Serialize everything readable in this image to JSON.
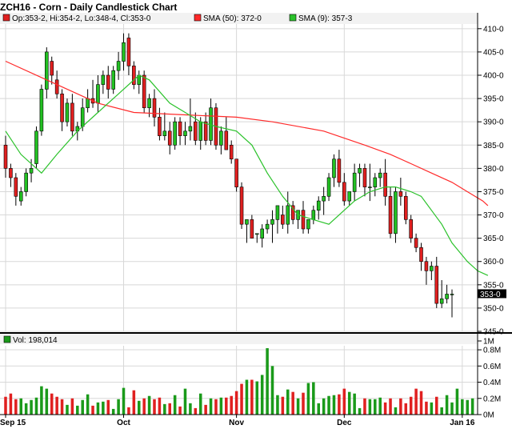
{
  "chart_data": {
    "type": "candlestick",
    "title": "ZCH16 - Corn - Daily Candlestick Chart",
    "legend": {
      "ohlc": "Op:353-2, Hi:354-2, Lo:348-4, Cl:353-0",
      "sma50": "SMA (50): 372-0",
      "sma9": "SMA (9): 357-3",
      "volume": "Vol: 198,014"
    },
    "last_price_label": "353-0",
    "colors": {
      "up": "#22c022",
      "down": "#e02020",
      "sma50": "#ff2a2a",
      "sma9": "#2bc22b",
      "vol_up": "#1a9a1a",
      "vol_down": "#e02020"
    },
    "price_axis": {
      "ylim": [
        345,
        411
      ],
      "ticks": [
        "345-0",
        "350-0",
        "355-0",
        "360-0",
        "365-0",
        "370-0",
        "375-0",
        "380-0",
        "385-0",
        "390-0",
        "395-0",
        "400-0",
        "405-0",
        "410-0"
      ]
    },
    "volume_axis": {
      "ylim": [
        0,
        0.85
      ],
      "ticks": [
        "0M",
        "0.2M",
        "0.4M",
        "0.6M",
        "0.8M",
        "1M"
      ]
    },
    "x_labels": [
      {
        "label": "Sep 15",
        "index": 0
      },
      {
        "label": "Oct",
        "index": 23
      },
      {
        "label": "Nov",
        "index": 45
      },
      {
        "label": "Dec",
        "index": 66
      },
      {
        "label": "Jan 16",
        "index": 89
      }
    ],
    "candles": [
      [
        385,
        387,
        378,
        380
      ],
      [
        380,
        381,
        376,
        378
      ],
      [
        378,
        379,
        372,
        374
      ],
      [
        373,
        376,
        372,
        375
      ],
      [
        375,
        380,
        374,
        379
      ],
      [
        379,
        382,
        377,
        380
      ],
      [
        381,
        389,
        380,
        388
      ],
      [
        388,
        398,
        387,
        397
      ],
      [
        397,
        406,
        395,
        405
      ],
      [
        403,
        404,
        398,
        400
      ],
      [
        399,
        401,
        395,
        396
      ],
      [
        396,
        397,
        388,
        390
      ],
      [
        390,
        395,
        389,
        394
      ],
      [
        394,
        396,
        387,
        388
      ],
      [
        388,
        390,
        386,
        389
      ],
      [
        389,
        395,
        388,
        393
      ],
      [
        393,
        397,
        392,
        395
      ],
      [
        395,
        399,
        393,
        394
      ],
      [
        394,
        400,
        392,
        398
      ],
      [
        398,
        401,
        396,
        400
      ],
      [
        400,
        402,
        395,
        397
      ],
      [
        397,
        402,
        396,
        401
      ],
      [
        401,
        405,
        399,
        403
      ],
      [
        403,
        409,
        401,
        407
      ],
      [
        408,
        409,
        400,
        402
      ],
      [
        402,
        403,
        397,
        398
      ],
      [
        398,
        401,
        396,
        400
      ],
      [
        400,
        401,
        392,
        393
      ],
      [
        393,
        396,
        391,
        395
      ],
      [
        395,
        397,
        389,
        391
      ],
      [
        391,
        393,
        386,
        387
      ],
      [
        387,
        392,
        386,
        388
      ],
      [
        388,
        390,
        383,
        385
      ],
      [
        385,
        391,
        384,
        390
      ],
      [
        390,
        391,
        385,
        387
      ],
      [
        387,
        390,
        385,
        388
      ],
      [
        388,
        395,
        386,
        389
      ],
      [
        390,
        392,
        385,
        386
      ],
      [
        386,
        391,
        384,
        390
      ],
      [
        390,
        392,
        385,
        386
      ],
      [
        386,
        395,
        385,
        393
      ],
      [
        393,
        394,
        384,
        385
      ],
      [
        385,
        389,
        383,
        388
      ],
      [
        388,
        391,
        384,
        384
      ],
      [
        385,
        386,
        381,
        382
      ],
      [
        382,
        382,
        375,
        376
      ],
      [
        376,
        377,
        367,
        368
      ],
      [
        368,
        369,
        364,
        369
      ],
      [
        369,
        370,
        365,
        365
      ],
      [
        366,
        366,
        364,
        366
      ],
      [
        365,
        368,
        363,
        367
      ],
      [
        367,
        369,
        366,
        368
      ],
      [
        368,
        371,
        364,
        369
      ],
      [
        369,
        372,
        366,
        372
      ],
      [
        370,
        372,
        367,
        368
      ],
      [
        368,
        375,
        366,
        372
      ],
      [
        372,
        373,
        368,
        369
      ],
      [
        369,
        371,
        367,
        371
      ],
      [
        371,
        373,
        366,
        367
      ],
      [
        367,
        369,
        366,
        369
      ],
      [
        369,
        372,
        368,
        371
      ],
      [
        371,
        374,
        369,
        373
      ],
      [
        373,
        376,
        370,
        374
      ],
      [
        374,
        379,
        373,
        378
      ],
      [
        378,
        383,
        376,
        382
      ],
      [
        382,
        384,
        376,
        377
      ],
      [
        377,
        379,
        372,
        373
      ],
      [
        373,
        375,
        372,
        375
      ],
      [
        375,
        381,
        373,
        379
      ],
      [
        379,
        381,
        376,
        380
      ],
      [
        380,
        381,
        374,
        376
      ],
      [
        376,
        381,
        373,
        376
      ],
      [
        376,
        379,
        374,
        378
      ],
      [
        378,
        380,
        376,
        379
      ],
      [
        379,
        382,
        372,
        374
      ],
      [
        374,
        376,
        365,
        366
      ],
      [
        366,
        376,
        364,
        375
      ],
      [
        375,
        378,
        372,
        374
      ],
      [
        374,
        375,
        368,
        369
      ],
      [
        369,
        370,
        364,
        365
      ],
      [
        365,
        366,
        362,
        363
      ],
      [
        363,
        364,
        358,
        360
      ],
      [
        360,
        361,
        355,
        358
      ],
      [
        358,
        360,
        356,
        359
      ],
      [
        359,
        361,
        350,
        351
      ],
      [
        351,
        356,
        350,
        352
      ],
      [
        352,
        355,
        351,
        353
      ],
      [
        353,
        354,
        348,
        353
      ]
    ],
    "sma50": [
      [
        0,
        403
      ],
      [
        8,
        399
      ],
      [
        18,
        394
      ],
      [
        25,
        392
      ],
      [
        35,
        391.5
      ],
      [
        45,
        391
      ],
      [
        52,
        390
      ],
      [
        62,
        388
      ],
      [
        70,
        385
      ],
      [
        75,
        383
      ],
      [
        79,
        381
      ],
      [
        83,
        379
      ],
      [
        87,
        377
      ],
      [
        90,
        375
      ],
      [
        93,
        373
      ],
      [
        94,
        372
      ]
    ],
    "sma9": [
      [
        0,
        388
      ],
      [
        3,
        383
      ],
      [
        7,
        379
      ],
      [
        10,
        383
      ],
      [
        14,
        388
      ],
      [
        18,
        392
      ],
      [
        22,
        396
      ],
      [
        26,
        400
      ],
      [
        28,
        399
      ],
      [
        32,
        394
      ],
      [
        35,
        392
      ],
      [
        38,
        390
      ],
      [
        41,
        389
      ],
      [
        45,
        388
      ],
      [
        48,
        385
      ],
      [
        51,
        379
      ],
      [
        54,
        374
      ],
      [
        57,
        370
      ],
      [
        60,
        369
      ],
      [
        63,
        368
      ],
      [
        66,
        371
      ],
      [
        68,
        373
      ],
      [
        71,
        375
      ],
      [
        74,
        376
      ],
      [
        76,
        376
      ],
      [
        79,
        375
      ],
      [
        81,
        374
      ],
      [
        83,
        371
      ],
      [
        85,
        368
      ],
      [
        87,
        364
      ],
      [
        90,
        360
      ],
      [
        92,
        358
      ],
      [
        94,
        357
      ]
    ],
    "volume": [
      0.22,
      0.26,
      0.19,
      0.2,
      0.14,
      0.18,
      0.21,
      0.35,
      0.32,
      0.26,
      0.22,
      0.19,
      0.12,
      0.2,
      0.11,
      0.18,
      0.25,
      0.11,
      0.15,
      0.16,
      0.18,
      0.07,
      0.19,
      0.33,
      0.09,
      0.3,
      0.17,
      0.2,
      0.23,
      0.19,
      0.21,
      0.13,
      0.14,
      0.24,
      0.1,
      0.32,
      0.14,
      0.08,
      0.26,
      0.12,
      0.2,
      0.19,
      0.21,
      0.21,
      0.23,
      0.29,
      0.38,
      0.43,
      0.43,
      0.41,
      0.49,
      0.82,
      0.6,
      0.24,
      0.22,
      0.31,
      0.28,
      0.2,
      0.27,
      0.39,
      0.4,
      0.14,
      0.2,
      0.23,
      0.24,
      0.25,
      0.32,
      0.28,
      0.26,
      0.08,
      0.2,
      0.19,
      0.19,
      0.21,
      0.15,
      0.2,
      0.09,
      0.2,
      0.14,
      0.22,
      0.32,
      0.29,
      0.16,
      0.15,
      0.22,
      0.09,
      0.24,
      0.15,
      0.32,
      0.19,
      0.18,
      0.2
    ]
  }
}
